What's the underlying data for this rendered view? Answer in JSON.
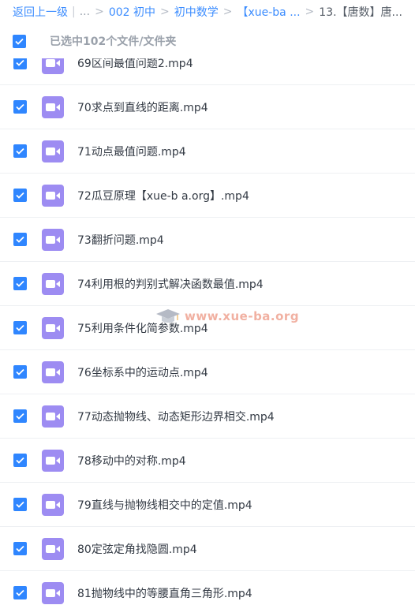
{
  "breadcrumb": {
    "back": "返回上一级",
    "ellipsis": "...",
    "items": [
      "002 初中",
      "初中数学",
      "【xue-ba ...",
      "13.【唐数】唐..."
    ]
  },
  "selection": {
    "text": "已选中102个文件/文件夹"
  },
  "files": [
    "69区间最值问题2.mp4",
    "70求点到直线的距离.mp4",
    "71动点最值问题.mp4",
    "72瓜豆原理【xue-b a.org】.mp4",
    "73翻折问题.mp4",
    "74利用根的判别式解决函数最值.mp4",
    "75利用条件化简参数.mp4",
    "76坐标系中的运动点.mp4",
    "77动态抛物线、动态矩形边界相交.mp4",
    "78移动中的对称.mp4",
    "79直线与抛物线相交中的定值.mp4",
    "80定弦定角找隐圆.mp4",
    "81抛物线中的等腰直角三角形.mp4"
  ],
  "watermark": "www.xue-ba.org",
  "colors": {
    "accent": "#2f86ff",
    "video_icon": "#9d8cf2",
    "watermark": "#ec9682"
  }
}
